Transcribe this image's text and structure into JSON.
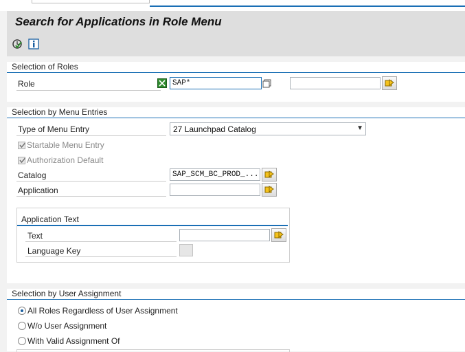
{
  "header": {
    "title": "Search for Applications in Role Menu",
    "toolbar": {
      "execute_icon": "execute-icon",
      "info_icon": "info-icon"
    }
  },
  "roles_section": {
    "title": "Selection of Roles",
    "role_label": "Role",
    "role_value": "SAP*",
    "role_to_value": ""
  },
  "menu_section": {
    "title": "Selection by Menu Entries",
    "type_label": "Type of Menu Entry",
    "type_value": "27 Launchpad Catalog",
    "startable_label": "Startable Menu Entry",
    "startable_checked": true,
    "authorization_label": "Authorization Default",
    "authorization_checked": true,
    "catalog_label": "Catalog",
    "catalog_value": "SAP_SCM_BC_PROD_...",
    "application_label": "Application",
    "application_value": "",
    "apptext": {
      "title": "Application Text",
      "text_label": "Text",
      "text_value": "",
      "language_label": "Language Key"
    }
  },
  "user_section": {
    "title": "Selection by User Assignment",
    "options": [
      {
        "label": "All Roles Regardless of User Assignment",
        "selected": true
      },
      {
        "label": "W/o User Assignment",
        "selected": false
      },
      {
        "label": "With Valid Assignment Of",
        "selected": false
      }
    ]
  },
  "colors": {
    "accent": "#1a6fb5",
    "header_bg": "#dedede",
    "page_bg": "#f2f2f2"
  }
}
